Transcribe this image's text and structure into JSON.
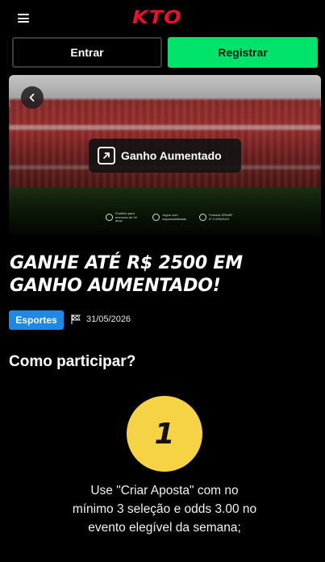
{
  "header": {
    "logo": "KTO",
    "menu_icon": "hamburger-icon"
  },
  "auth": {
    "login_label": "Entrar",
    "register_label": "Registrar"
  },
  "banner": {
    "back_icon": "chevron-left-icon",
    "badge_icon": "arrow-up-right-icon",
    "badge_label": "Ganho Aumentado",
    "notes": [
      {
        "icon": "age-restriction-icon",
        "text": "Proibido para menores de 18 anos"
      },
      {
        "icon": "responsible-gaming-icon",
        "text": "Jogue com responsabilidade"
      },
      {
        "icon": "license-shield-icon",
        "text": "Portaria SPA/MF nº 2.090/2024"
      }
    ]
  },
  "promo": {
    "headline": "GANHE ATÉ R$ 2500 EM GANHO AUMENTADO!",
    "category": "Esportes",
    "flag_icon": "checkered-flag-icon",
    "end_date": "31/05/2026"
  },
  "how_to": {
    "title": "Como participar?",
    "steps": [
      {
        "number": "1",
        "text": "Use \"Criar Aposta\" com no mínimo 3 seleção e odds 3.00 no evento elegível da semana;"
      }
    ]
  },
  "colors": {
    "brand_red": "#e8102f",
    "register_green": "#00e36b",
    "tag_blue": "#1e88e5",
    "step_yellow": "#f6d344",
    "background": "#000000"
  }
}
